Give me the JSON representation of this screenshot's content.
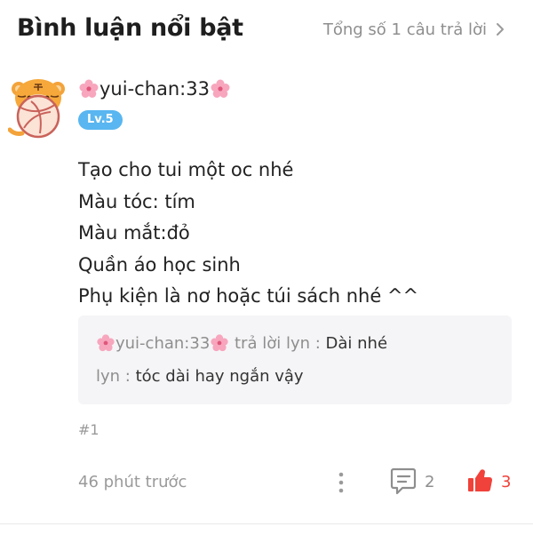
{
  "header": {
    "title": "Bình luận nổi bật",
    "total_replies": "Tổng số 1 câu trả lời"
  },
  "comment": {
    "author": "yui-chan:33",
    "level": "Lv.5",
    "lines": [
      "Tạo cho tui một oc nhé",
      "Màu tóc: tím",
      "Màu mắt:đỏ",
      "Quần áo học sinh",
      "Phụ kiện là nơ hoặc túi sách nhé ^^"
    ],
    "replies": [
      {
        "author": "yui-chan:33",
        "action": " trả lời lyn : ",
        "text": "Dài nhé"
      },
      {
        "author": "lyn : ",
        "text": "tóc dài hay ngắn vậy"
      }
    ],
    "floor": "#1",
    "time": "46 phút trước",
    "comment_count": "2",
    "like_count": "3"
  },
  "colors": {
    "like_red": "#f0413a",
    "badge_blue": "#59b6f0",
    "muted_gray": "#8e8e8e",
    "reply_bg": "#f5f5f7"
  }
}
